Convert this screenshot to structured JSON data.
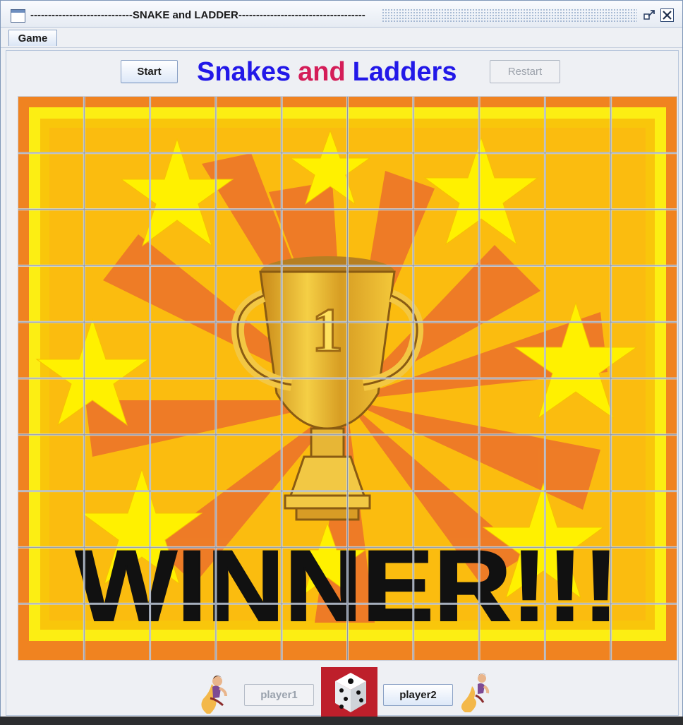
{
  "window": {
    "title": "-----------------------------SNAKE and LADDER------------------------------------"
  },
  "menu": {
    "game_label": "Game"
  },
  "controls": {
    "start_label": "Start",
    "restart_label": "Restart",
    "title_part1": "Snakes",
    "title_part2": "and",
    "title_part3": "Ladders"
  },
  "board": {
    "banner_text": "WINNER!!!",
    "trophy_number": "1",
    "rows": 10,
    "cols": 10
  },
  "players": {
    "player1_label": "player1",
    "player2_label": "player2",
    "active_player": "player2"
  },
  "colors": {
    "title_blue": "#2218e8",
    "title_red": "#d41d58",
    "board_orange": "#f08320",
    "board_yellow": "#fbbd0d",
    "dice_red": "#be1f2b"
  },
  "icons": {
    "window_icon": "window-icon",
    "restore_icon": "restore-icon",
    "close_icon": "close-icon",
    "dice_icon": "dice-icon",
    "player1_avatar": "genie-avatar",
    "player2_avatar": "genie-avatar"
  }
}
